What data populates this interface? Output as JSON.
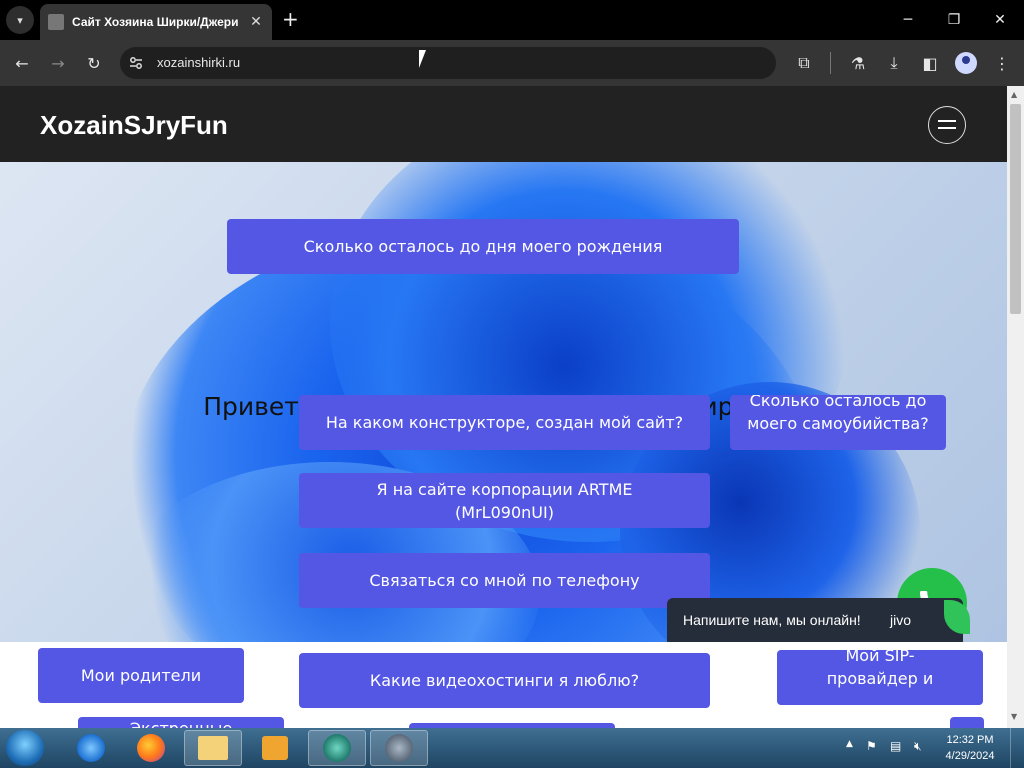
{
  "browser": {
    "tab": {
      "title": "Сайт Хозяина Ширки/Джери"
    },
    "url": "xozainshirki.ru"
  },
  "site": {
    "logo": "XozainSJryFun",
    "hero_title": "Привет! Ты зашел на сайт Хозяина Ширки/Джери.",
    "buttons": {
      "birthday": "Сколько осталось до дня моего рождения",
      "constructor": "На каком конструкторе, создан мой сайт?",
      "suicide": "Сколько осталось до моего самоубийства?",
      "artme_line1": "Я на сайте корпорации ARTME",
      "artme_line2": "(MrL090nUI)",
      "phone": "Связаться со мной по телефону",
      "parents": "Мои родители",
      "video": "Какие видеохостинги я люблю?",
      "sip": "Мой SIP-провайдер и",
      "emergency": "Экстренные"
    },
    "colors": {
      "accent": "#5457e3",
      "header_bg": "#222222",
      "call_green": "#25c04a"
    }
  },
  "chat_widget": {
    "prompt": "Напишите нам, мы онлайн!",
    "brand": "jivo"
  },
  "taskbar": {
    "time": "12:32 PM",
    "date": "4/29/2024"
  }
}
